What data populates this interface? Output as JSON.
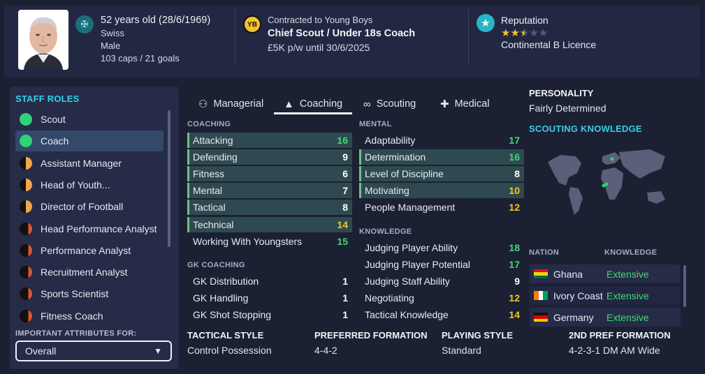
{
  "header": {
    "age_line": "52 years old (28/6/1969)",
    "nationality": "Swiss",
    "gender": "Male",
    "caps": "103 caps / 21 goals",
    "contract_club": "Contracted to Young Boys",
    "job_title": "Chief Scout / Under 18s Coach",
    "wage": "£5K p/w until 30/6/2025",
    "reputation_label": "Reputation",
    "reputation_stars": 2.5,
    "licence": "Continental B Licence"
  },
  "roles": {
    "title": "STAFF ROLES",
    "items": [
      {
        "label": "Scout",
        "color": "#2fd37a",
        "fill": "full"
      },
      {
        "label": "Coach",
        "color": "#2fd37a",
        "fill": "full"
      },
      {
        "label": "Assistant Manager",
        "color": "#f2a54a",
        "fill": "half"
      },
      {
        "label": "Head of Youth...",
        "color": "#f2a54a",
        "fill": "half"
      },
      {
        "label": "Director of Football",
        "color": "#f2a54a",
        "fill": "half"
      },
      {
        "label": "Head Performance Analyst",
        "color": "#e0552f",
        "fill": "sliver"
      },
      {
        "label": "Performance Analyst",
        "color": "#e0552f",
        "fill": "sliver"
      },
      {
        "label": "Recruitment Analyst",
        "color": "#e0552f",
        "fill": "sliver"
      },
      {
        "label": "Sports Scientist",
        "color": "#e0552f",
        "fill": "sliver"
      },
      {
        "label": "Fitness Coach",
        "color": "#e0552f",
        "fill": "sliver"
      }
    ],
    "important_label": "IMPORTANT ATTRIBUTES FOR:",
    "dropdown_value": "Overall"
  },
  "tabs": [
    {
      "label": "Managerial",
      "icon": "person-tree-icon"
    },
    {
      "label": "Coaching",
      "icon": "cone-icon"
    },
    {
      "label": "Scouting",
      "icon": "binoculars-icon"
    },
    {
      "label": "Medical",
      "icon": "medkit-icon"
    }
  ],
  "coaching": {
    "title": "COACHING",
    "rows": [
      {
        "label": "Attacking",
        "value": "16",
        "hl": true
      },
      {
        "label": "Defending",
        "value": "9",
        "hl": true
      },
      {
        "label": "Fitness",
        "value": "6",
        "hl": true
      },
      {
        "label": "Mental",
        "value": "7",
        "hl": true
      },
      {
        "label": "Tactical",
        "value": "8",
        "hl": true
      },
      {
        "label": "Technical",
        "value": "14",
        "hl": true
      },
      {
        "label": "Working With Youngsters",
        "value": "15",
        "hl": false
      }
    ]
  },
  "gk_coaching": {
    "title": "GK COACHING",
    "rows": [
      {
        "label": "GK Distribution",
        "value": "1"
      },
      {
        "label": "GK Handling",
        "value": "1"
      },
      {
        "label": "GK Shot Stopping",
        "value": "1"
      }
    ]
  },
  "mental": {
    "title": "MENTAL",
    "rows": [
      {
        "label": "Adaptability",
        "value": "17",
        "hl": false
      },
      {
        "label": "Determination",
        "value": "16",
        "hl": true
      },
      {
        "label": "Level of Discipline",
        "value": "8",
        "hl": true
      },
      {
        "label": "Motivating",
        "value": "10",
        "hl": true
      },
      {
        "label": "People Management",
        "value": "12",
        "hl": false
      }
    ]
  },
  "knowledge": {
    "title": "KNOWLEDGE",
    "rows": [
      {
        "label": "Judging Player Ability",
        "value": "18"
      },
      {
        "label": "Judging Player Potential",
        "value": "17"
      },
      {
        "label": "Judging Staff Ability",
        "value": "9"
      },
      {
        "label": "Negotiating",
        "value": "12"
      },
      {
        "label": "Tactical Knowledge",
        "value": "14"
      }
    ]
  },
  "value_colors": {
    "high": "#3fdc6f",
    "mid": "#f3c623",
    "low": "#ffffff"
  },
  "bottom": {
    "tactical_style_label": "TACTICAL STYLE",
    "tactical_style": "Control Possession",
    "pref_formation_label": "PREFERRED FORMATION",
    "pref_formation": "4-4-2",
    "playing_style_label": "PLAYING STYLE",
    "playing_style": "Standard",
    "second_formation_label": "2ND PREF FORMATION",
    "second_formation": "4-2-3-1 DM AM Wide"
  },
  "personality": {
    "title": "PERSONALITY",
    "value": "Fairly Determined"
  },
  "scouting_knowledge": {
    "title": "SCOUTING KNOWLEDGE",
    "nation_header": "NATION",
    "knowledge_header": "KNOWLEDGE",
    "nations": [
      {
        "name": "Ghana",
        "level": "Extensive",
        "flag": "ghana"
      },
      {
        "name": "Ivory Coast",
        "level": "Extensive",
        "flag": "ivory-coast"
      },
      {
        "name": "Germany",
        "level": "Extensive",
        "flag": "germany"
      }
    ]
  }
}
